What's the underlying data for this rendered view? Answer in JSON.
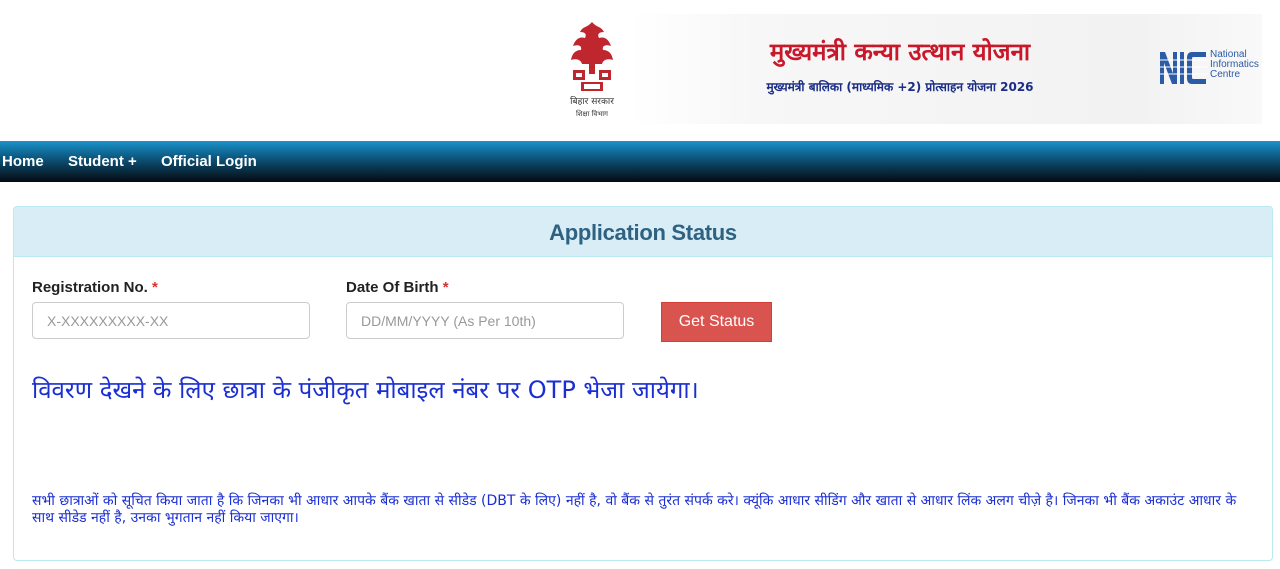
{
  "header": {
    "emblem_caption": "बिहार सरकार",
    "emblem_subcaption": "शिक्षा विभाग",
    "scheme_title": "मुख्यमंत्री कन्या उत्थान योजना",
    "scheme_subtitle": "मुख्यमंत्री बालिका (माध्यमिक +2) प्रोत्साहन योजना 2026",
    "nic_line1": "National",
    "nic_line2": "Informatics",
    "nic_line3": "Centre",
    "nic_icon": "nic-logo-icon",
    "emblem_icon": "bihar-emblem-icon"
  },
  "nav": {
    "items": [
      {
        "label": "Home"
      },
      {
        "label": "Student +"
      },
      {
        "label": "Official Login"
      }
    ]
  },
  "panel": {
    "title": "Application Status",
    "registration": {
      "label": "Registration No.",
      "required": "*",
      "placeholder": "X-XXXXXXXXX-XX",
      "value": ""
    },
    "dob": {
      "label": "Date Of Birth",
      "required": "*",
      "placeholder": "DD/MM/YYYY (As Per 10th)",
      "value": ""
    },
    "get_status_label": "Get Status",
    "otp_notice": "विवरण देखने के लिए छात्रा के पंजीकृत मोबाइल नंबर पर OTP भेजा जायेगा।",
    "dbt_notice": "सभी छात्राओं को सूचित किया जाता है कि जिनका भी आधार आपके बैंक खाता से सीडेड (DBT के लिए) नहीं है, वो बैंक से तुरंत संपर्क करे। क्यूंकि आधार सीडिंग और खाता से आधार लिंक अलग चीज़े है। जिनका भी बैंक अकाउंट आधार के साथ सीडेड नहीं है, उनका भुगतान नहीं किया जाएगा।"
  },
  "colors": {
    "title_red": "#c8182a",
    "subtitle_blue": "#1b2d84",
    "panel_heading_bg": "#d9edf7",
    "panel_title": "#2f6281",
    "button_bg": "#d9534f",
    "notice_blue": "#1a2ed4"
  }
}
